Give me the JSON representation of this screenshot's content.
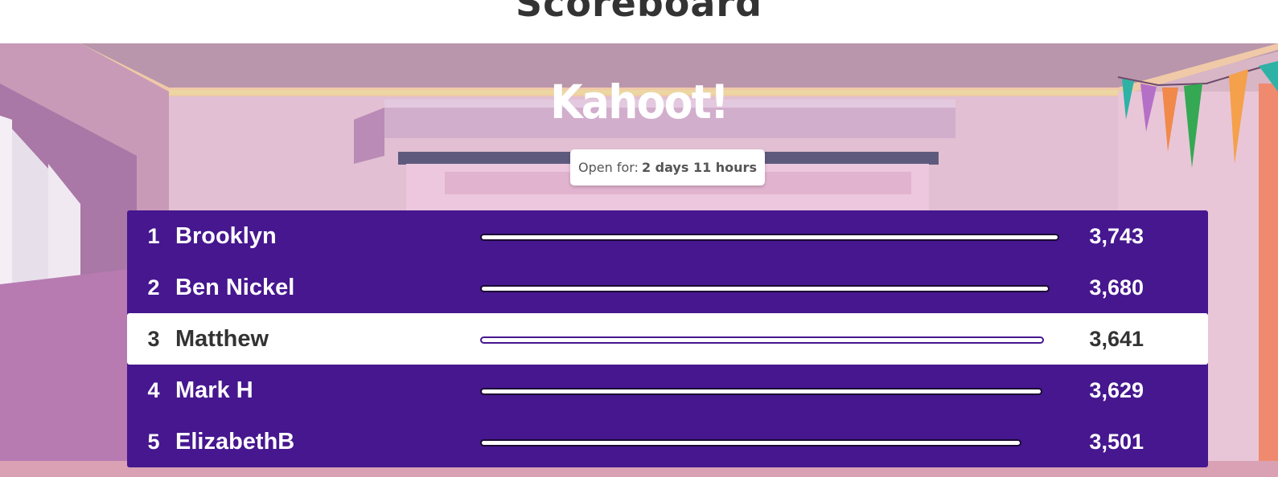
{
  "header": {
    "title": "Scoreboard"
  },
  "logo": {
    "text": "Kahoot!"
  },
  "timer": {
    "label": "Open for:",
    "value": "2 days 11 hours"
  },
  "colors": {
    "board": "#46178f",
    "highlight_row": "#ffffff"
  },
  "leaderboard": [
    {
      "rank": "1",
      "name": "Brooklyn",
      "score": "3,743",
      "bar_fraction": 1.0,
      "highlighted": false
    },
    {
      "rank": "2",
      "name": "Ben Nickel",
      "score": "3,680",
      "bar_fraction": 0.983,
      "highlighted": false
    },
    {
      "rank": "3",
      "name": "Matthew",
      "score": "3,641",
      "bar_fraction": 0.973,
      "highlighted": true
    },
    {
      "rank": "4",
      "name": "Mark H",
      "score": "3,629",
      "bar_fraction": 0.97,
      "highlighted": false
    },
    {
      "rank": "5",
      "name": "ElizabethB",
      "score": "3,501",
      "bar_fraction": 0.935,
      "highlighted": false
    }
  ]
}
